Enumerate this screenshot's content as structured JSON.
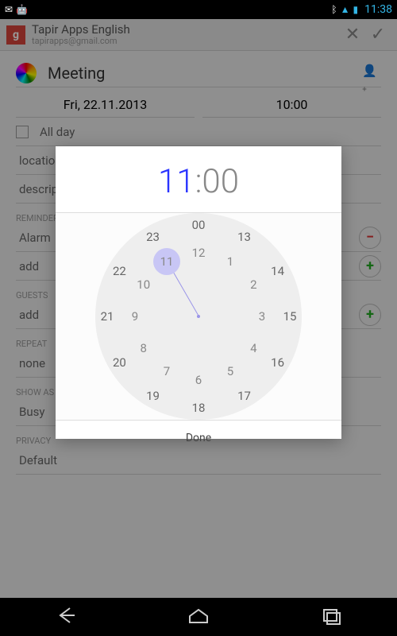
{
  "statusbar": {
    "time": "11:38"
  },
  "header": {
    "title": "Tapir Apps English",
    "subtitle": "tapirapps@gmail.com"
  },
  "event": {
    "title": "Meeting",
    "date": "Fri, 22.11.2013",
    "time": "10:00",
    "allday_label": "All day",
    "location_placeholder": "location",
    "description_placeholder": "description"
  },
  "sections": {
    "reminder_label": "REMINDER",
    "reminder_value": "Alarm",
    "guests_label": "GUESTS",
    "guests_placeholder": "add",
    "repeat_label": "REPEAT",
    "repeat_value": "none",
    "showas_label": "SHOW AS",
    "showas_value": "Busy",
    "privacy_label": "PRIVACY",
    "privacy_value": "Default"
  },
  "picker": {
    "hour": "11",
    "sep": ":",
    "minute": "00",
    "done": "Done",
    "selected_hour": 11,
    "inner": [
      "12",
      "1",
      "2",
      "3",
      "4",
      "5",
      "6",
      "7",
      "8",
      "9",
      "10",
      "11"
    ],
    "outer": [
      "00",
      "13",
      "14",
      "15",
      "16",
      "17",
      "18",
      "19",
      "20",
      "21",
      "22",
      "23"
    ]
  }
}
